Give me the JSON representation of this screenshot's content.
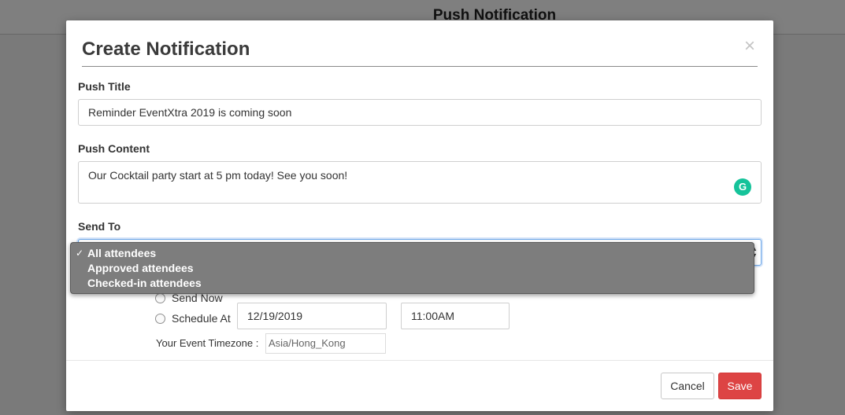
{
  "background": {
    "page_title": "Push Notification"
  },
  "modal": {
    "title": "Create Notification",
    "close_glyph": "×",
    "push_title": {
      "label": "Push Title",
      "value": "Reminder EventXtra 2019 is coming soon"
    },
    "push_content": {
      "label": "Push Content",
      "value": "Our Cocktail party start at 5 pm today! See you soon!",
      "grammarly_glyph": "G"
    },
    "send_to": {
      "label": "Send To",
      "options": [
        {
          "label": "All attendees",
          "selected": true
        },
        {
          "label": "Approved attendees",
          "selected": false
        },
        {
          "label": "Checked-in attendees",
          "selected": false
        }
      ],
      "check_glyph": "✓",
      "arrows_up": "▲",
      "arrows_down": "▼"
    },
    "schedule": {
      "send_now_label": "Send Now",
      "schedule_at_label": "Schedule At",
      "date_value": "12/19/2019",
      "time_value": "11:00AM",
      "timezone_label": "Your Event Timezone :",
      "timezone_value": "Asia/Hong_Kong"
    },
    "footer": {
      "cancel_label": "Cancel",
      "save_label": "Save"
    }
  },
  "colors": {
    "save_button": "#dd4444",
    "grammarly": "#15c39a",
    "select_focus": "#6aa6e8"
  }
}
